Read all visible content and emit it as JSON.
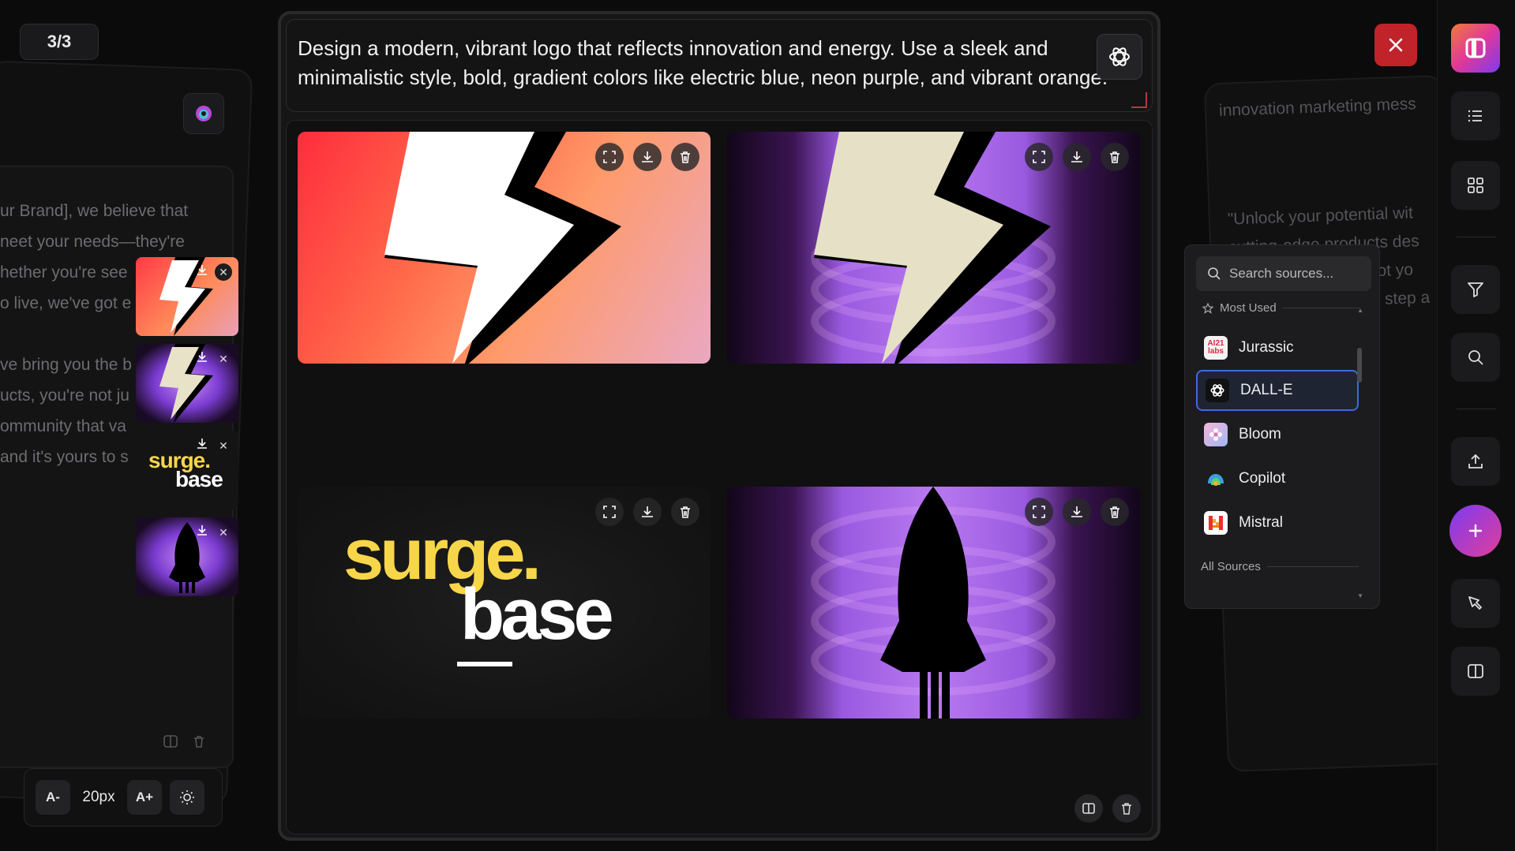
{
  "counter": "3/3",
  "prompt": "Design a modern, vibrant logo that reflects innovation and energy. Use a sleek and minimalistic style,  bold, gradient colors like electric blue, neon purple, and vibrant orange.",
  "background": {
    "left_lines": [
      "ur Brand], we believe that",
      "neet your needs—they're",
      "hether you're see",
      "o live, we've got e",
      "",
      "ve bring you the b",
      "ucts, you're not ju",
      "ommunity that va",
      "and it's yours to s"
    ],
    "right_header": "innovation marketing mess",
    "right_lines": [
      "\"Unlock your potential wit",
      "cutting-edge products des",
      "e got yo",
      "a step a"
    ]
  },
  "font_controls": {
    "decrease": "A-",
    "size": "20px",
    "increase": "A+"
  },
  "tiles": [
    {
      "id": "bolt-orange",
      "alt": "lightning bolt on orange gradient"
    },
    {
      "id": "bolt-purple",
      "alt": "lightning bolt on purple gradient"
    },
    {
      "id": "surge-base",
      "line1": "surge.",
      "line2": "base"
    },
    {
      "id": "rocket-purple",
      "alt": "rocket on purple gradient"
    }
  ],
  "thumbnails": [
    {
      "id": "thumb-bolt-orange"
    },
    {
      "id": "thumb-bolt-purple"
    },
    {
      "id": "thumb-surge",
      "line1": "surge.",
      "line2": "base"
    },
    {
      "id": "thumb-rocket"
    }
  ],
  "dropdown": {
    "search_placeholder": "Search sources...",
    "most_used_label": "Most Used",
    "all_sources_label": "All Sources",
    "items": [
      {
        "label": "Jurassic",
        "icon": "ai21-labs-icon",
        "icon_text": "AI21 labs"
      },
      {
        "label": "DALL-E",
        "icon": "openai-icon",
        "selected": true
      },
      {
        "label": "Bloom",
        "icon": "bloom-icon"
      },
      {
        "label": "Copilot",
        "icon": "copilot-icon"
      },
      {
        "label": "Mistral",
        "icon": "mistral-icon"
      }
    ]
  },
  "colors": {
    "accent_blue": "#3f6bdc",
    "close_red": "#c0232a",
    "surge_yellow": "#f7d64a",
    "fab_gradient": [
      "#7b3cf0",
      "#e23d9a"
    ]
  }
}
